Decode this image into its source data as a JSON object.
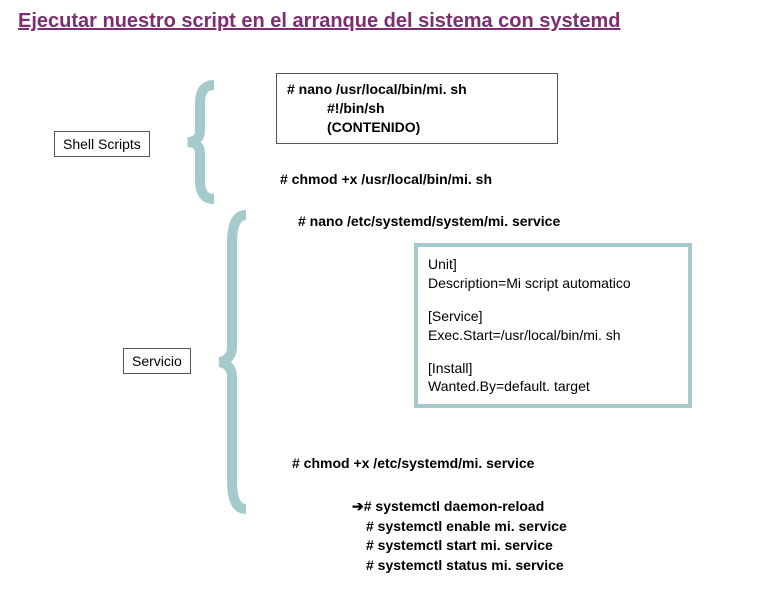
{
  "title": "Ejecutar nuestro script en el arranque del sistema con systemd",
  "shell_label": "Shell Scripts",
  "servicio_label": "Servicio",
  "nano_script": {
    "cmd": "# nano /usr/local/bin/mi. sh",
    "line1": "#!/bin/sh",
    "line2": "(CONTENIDO)"
  },
  "chmod_script": "# chmod +x /usr/local/bin/mi. sh",
  "nano_service": "# nano /etc/systemd/system/mi. service",
  "unit": {
    "header": "Unit]",
    "desc": "Description=Mi script automatico",
    "service_header": "[Service]",
    "exec": "Exec.Start=/usr/local/bin/mi. sh",
    "install_header": "[Install]",
    "wanted": "Wanted.By=default. target"
  },
  "chmod_service": "# chmod +x /etc/systemd/mi. service",
  "final": {
    "arrow": "➔",
    "l1": "# systemctl daemon-reload",
    "l2": "# systemctl enable mi. service",
    "l3": "# systemctl start mi. service",
    "l4": "# systemctl status mi. service"
  }
}
